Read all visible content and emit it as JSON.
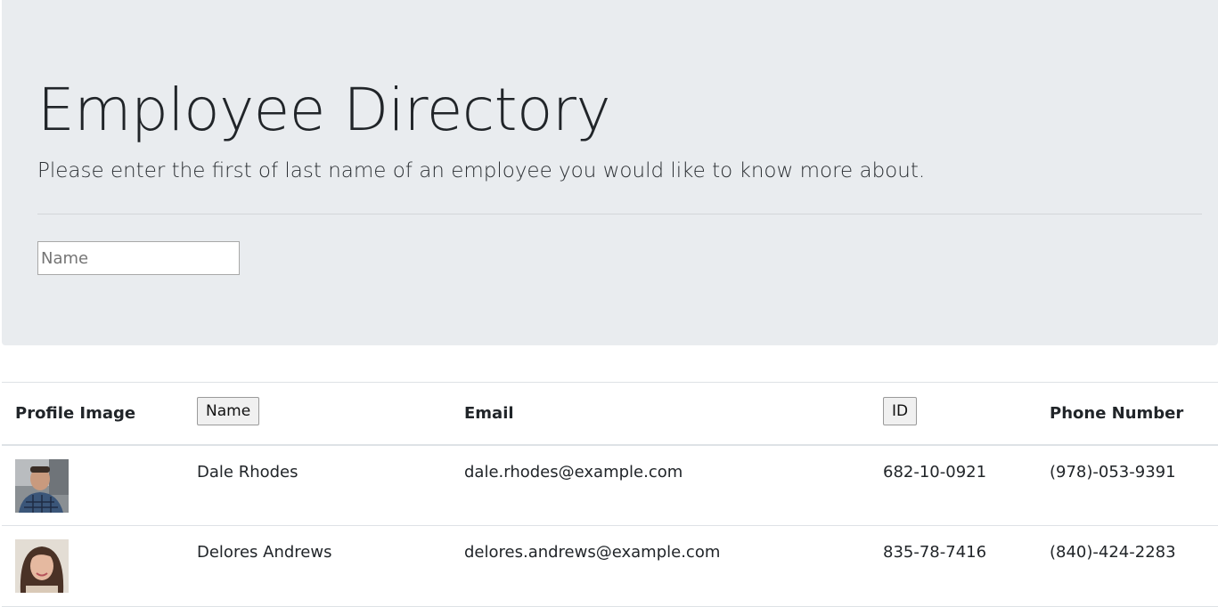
{
  "header": {
    "title": "Employee Directory",
    "lead": "Please enter the first of last name of an employee you would like to know more about.",
    "search_placeholder": "Name"
  },
  "table": {
    "columns": {
      "profile_image": "Profile Image",
      "name": "Name",
      "email": "Email",
      "id": "ID",
      "phone": "Phone Number"
    },
    "rows": [
      {
        "name": "Dale Rhodes",
        "email": "dale.rhodes@example.com",
        "id": "682-10-0921",
        "phone": "(978)-053-9391"
      },
      {
        "name": "Delores Andrews",
        "email": "delores.andrews@example.com",
        "id": "835-78-7416",
        "phone": "(840)-424-2283"
      }
    ]
  },
  "colors": {
    "jumbotron_bg": "#e9ecef",
    "border": "#dee2e6"
  }
}
